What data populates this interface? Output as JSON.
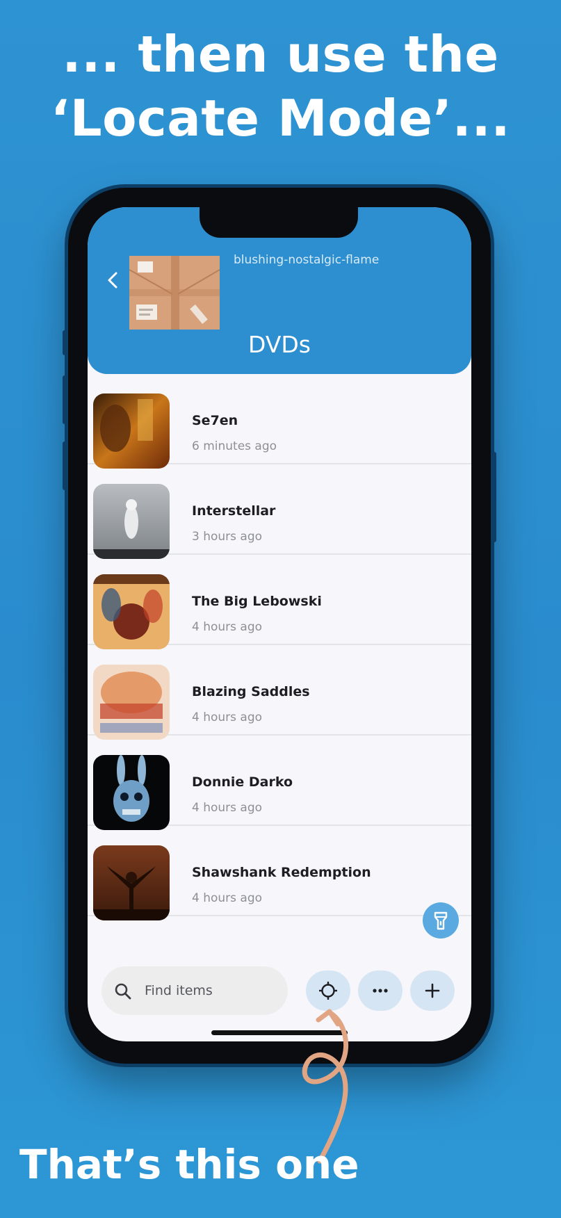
{
  "headline": {
    "line1": "... then use the",
    "line2": "‘Locate Mode’..."
  },
  "footer_caption": "That’s this one",
  "app": {
    "box_id": "blushing-nostalgic-flame",
    "box_title": "DVDs",
    "items": [
      {
        "title": "Se7en",
        "time": "6 minutes ago",
        "poster": "poster-se7en"
      },
      {
        "title": "Interstellar",
        "time": "3 hours ago",
        "poster": "poster-interstellar"
      },
      {
        "title": "The Big Lebowski",
        "time": "4 hours ago",
        "poster": "poster-big-lebowski"
      },
      {
        "title": "Blazing Saddles",
        "time": "4 hours ago",
        "poster": "poster-blazing-saddles"
      },
      {
        "title": "Donnie Darko",
        "time": "4 hours ago",
        "poster": "poster-donnie-darko"
      },
      {
        "title": "Shawshank Redemption",
        "time": "4 hours ago",
        "poster": "poster-shawshank"
      }
    ],
    "search": {
      "placeholder": "Find items"
    },
    "icons": {
      "back": "chevron-left-icon",
      "torch": "flashlight-icon",
      "search": "search-icon",
      "locate": "crosshair-icon",
      "more": "more-icon",
      "add": "plus-icon"
    }
  },
  "colors": {
    "background": "#2e93d2",
    "header": "#2d8ed0",
    "pill": "#d5e5f4",
    "arrow": "#e2a583"
  }
}
